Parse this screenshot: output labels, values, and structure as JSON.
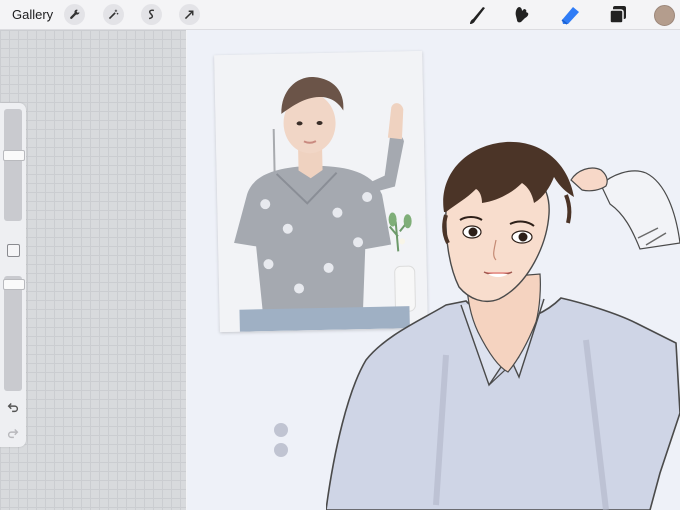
{
  "toolbar": {
    "gallery_label": "Gallery",
    "left_tools": [
      "wrench-icon",
      "magic-wand-icon",
      "selection-icon",
      "transform-arrow-icon"
    ],
    "right_tools": [
      "brush-icon",
      "smudge-icon",
      "eraser-icon",
      "layers-icon"
    ],
    "active_tool": "eraser-icon",
    "active_color": "#b49d8d",
    "accent": "#2f7cf6"
  },
  "sidebar": {
    "brush_size_level": 0.35,
    "opacity_level": 0.05
  }
}
